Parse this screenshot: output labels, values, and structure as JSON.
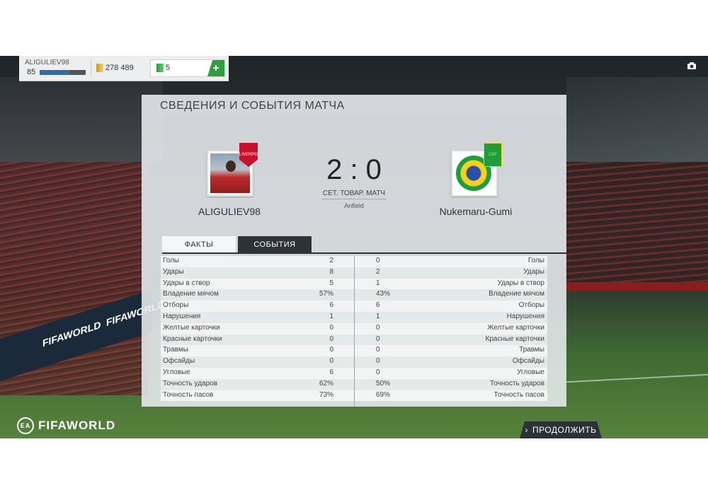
{
  "topbar": {
    "username": "ALIGULIEV98",
    "level": "85",
    "xp_progress": 0.65,
    "coins": "278 489",
    "points": "5",
    "add_label": "+"
  },
  "panel": {
    "title": "СВЕДЕНИЯ И СОБЫТИЯ МАТЧА",
    "home_team": "ALIGULIEV98",
    "away_team": "Nukemaru-Gumi",
    "score": "2 : 0",
    "match_type": "СЕТ. ТОВАР. МАТЧ",
    "stadium": "Anfield",
    "home_crest_text": "LIVERPOOL",
    "away_crest_text": "CBF"
  },
  "tabs": {
    "facts": "ФАКТЫ",
    "events": "СОБЫТИЯ"
  },
  "stats": [
    {
      "label": "Голы",
      "home": "2",
      "away": "0"
    },
    {
      "label": "Удары",
      "home": "8",
      "away": "2"
    },
    {
      "label": "Удары в створ",
      "home": "5",
      "away": "1"
    },
    {
      "label": "Владение мячом",
      "home": "57%",
      "away": "43%"
    },
    {
      "label": "Отборы",
      "home": "6",
      "away": "6"
    },
    {
      "label": "Нарушения",
      "home": "1",
      "away": "1"
    },
    {
      "label": "Желтые карточки",
      "home": "0",
      "away": "0"
    },
    {
      "label": "Красные карточки",
      "home": "0",
      "away": "0"
    },
    {
      "label": "Травмы",
      "home": "0",
      "away": "0"
    },
    {
      "label": "Офсайды",
      "home": "0",
      "away": "0"
    },
    {
      "label": "Угловые",
      "home": "6",
      "away": "0"
    },
    {
      "label": "Точность ударов",
      "home": "62%",
      "away": "50%"
    },
    {
      "label": "Точность пасов",
      "home": "73%",
      "away": "69%"
    }
  ],
  "footer": {
    "brand": "FIFAWORLD",
    "ea": "EA",
    "continue_label": "ПРОДОЛЖИТЬ",
    "board_text": "FIFAWORLD"
  },
  "icons": {
    "camera": "camera-icon",
    "coins": "coins-icon",
    "points": "points-icon",
    "chevron": "chevron-right-icon"
  }
}
